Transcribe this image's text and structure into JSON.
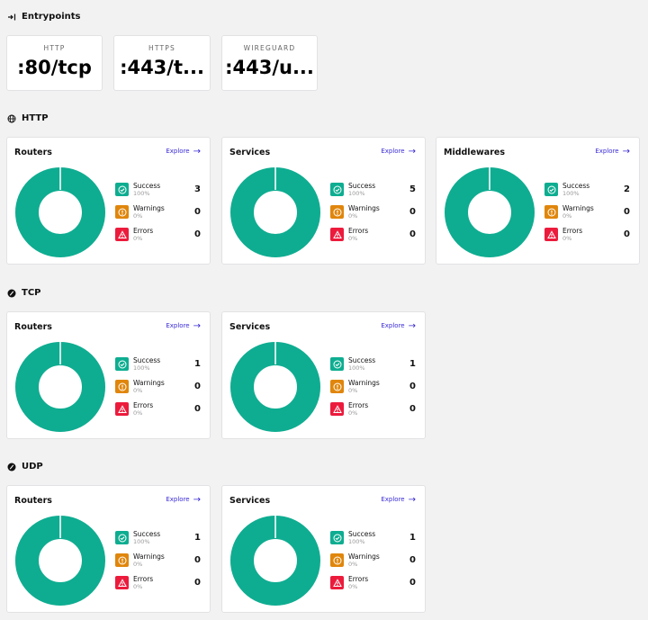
{
  "colors": {
    "success": "#0ead91",
    "warning": "#e0860c",
    "error": "#ec1b3c",
    "link": "#3a2bd6"
  },
  "entrypoints": {
    "title": "Entrypoints",
    "icon": "entrypoint-arrow-icon",
    "items": [
      {
        "label": "HTTP",
        "value": ":80/tcp"
      },
      {
        "label": "HTTPS",
        "value": ":443/t..."
      },
      {
        "label": "WIREGUARD",
        "value": ":443/u..."
      }
    ]
  },
  "sections": [
    {
      "title": "HTTP",
      "icon": "globe-icon",
      "cards": [
        {
          "title": "Routers",
          "explore": "Explore",
          "stats": [
            {
              "name": "Success",
              "pct": "100%",
              "count": "3",
              "level": 1.0
            },
            {
              "name": "Warnings",
              "pct": "0%",
              "count": "0"
            },
            {
              "name": "Errors",
              "pct": "0%",
              "count": "0"
            }
          ]
        },
        {
          "title": "Services",
          "explore": "Explore",
          "stats": [
            {
              "name": "Success",
              "pct": "100%",
              "count": "5",
              "level": 1.0
            },
            {
              "name": "Warnings",
              "pct": "0%",
              "count": "0"
            },
            {
              "name": "Errors",
              "pct": "0%",
              "count": "0"
            }
          ]
        },
        {
          "title": "Middlewares",
          "explore": "Explore",
          "stats": [
            {
              "name": "Success",
              "pct": "100%",
              "count": "2",
              "level": 1.0
            },
            {
              "name": "Warnings",
              "pct": "0%",
              "count": "0"
            },
            {
              "name": "Errors",
              "pct": "0%",
              "count": "0"
            }
          ]
        }
      ]
    },
    {
      "title": "TCP",
      "icon": "protocol-icon",
      "cards": [
        {
          "title": "Routers",
          "explore": "Explore",
          "stats": [
            {
              "name": "Success",
              "pct": "100%",
              "count": "1",
              "level": 1.0
            },
            {
              "name": "Warnings",
              "pct": "0%",
              "count": "0"
            },
            {
              "name": "Errors",
              "pct": "0%",
              "count": "0"
            }
          ]
        },
        {
          "title": "Services",
          "explore": "Explore",
          "stats": [
            {
              "name": "Success",
              "pct": "100%",
              "count": "1",
              "level": 1.0
            },
            {
              "name": "Warnings",
              "pct": "0%",
              "count": "0"
            },
            {
              "name": "Errors",
              "pct": "0%",
              "count": "0"
            }
          ]
        }
      ]
    },
    {
      "title": "UDP",
      "icon": "protocol-icon",
      "cards": [
        {
          "title": "Routers",
          "explore": "Explore",
          "stats": [
            {
              "name": "Success",
              "pct": "100%",
              "count": "1",
              "level": 1.0
            },
            {
              "name": "Warnings",
              "pct": "0%",
              "count": "0"
            },
            {
              "name": "Errors",
              "pct": "0%",
              "count": "0"
            }
          ]
        },
        {
          "title": "Services",
          "explore": "Explore",
          "stats": [
            {
              "name": "Success",
              "pct": "100%",
              "count": "1",
              "level": 1.0
            },
            {
              "name": "Warnings",
              "pct": "0%",
              "count": "0"
            },
            {
              "name": "Errors",
              "pct": "0%",
              "count": "0"
            }
          ]
        }
      ]
    }
  ]
}
